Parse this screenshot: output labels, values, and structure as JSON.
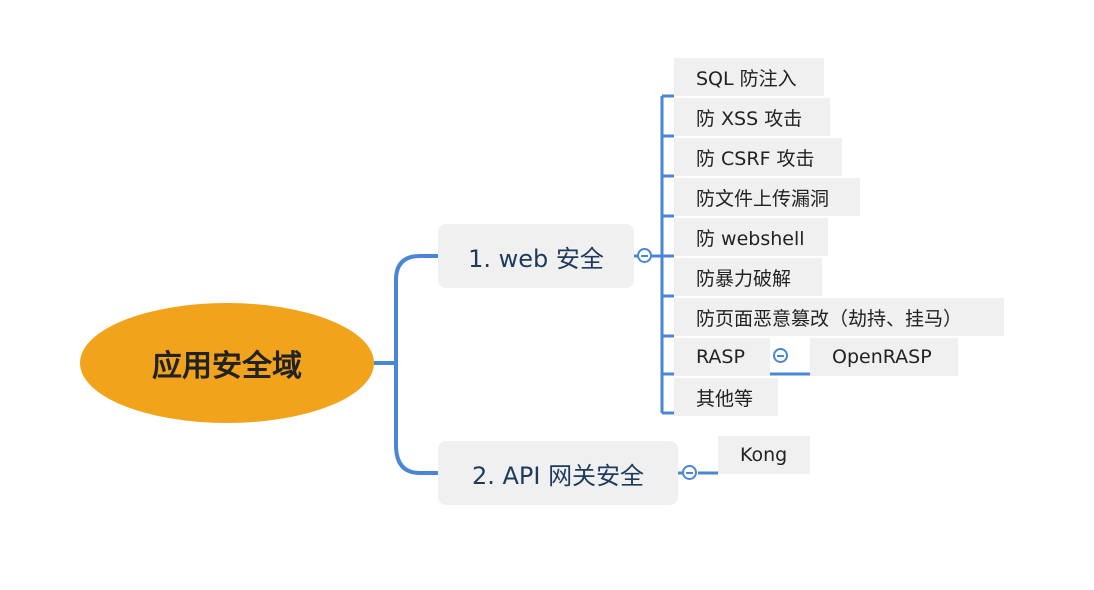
{
  "root": {
    "label": "应用安全域"
  },
  "branches": [
    {
      "label": "1. web 安全",
      "children": [
        {
          "label": "SQL 防注入"
        },
        {
          "label": "防 XSS 攻击"
        },
        {
          "label": "防 CSRF 攻击"
        },
        {
          "label": "防文件上传漏洞"
        },
        {
          "label": "防 webshell"
        },
        {
          "label": "防暴力破解"
        },
        {
          "label": "防页面恶意篡改（劫持、挂马）"
        },
        {
          "label": "RASP",
          "child": "OpenRASP"
        },
        {
          "label": "其他等"
        }
      ]
    },
    {
      "label": "2. API 网关安全",
      "children": [
        {
          "label": "Kong"
        }
      ]
    }
  ],
  "colors": {
    "root_fill": "#f2a31c",
    "connector": "#4a86d6",
    "node_fill": "#f0f0f0",
    "branch_text": "#1f3a5c"
  }
}
